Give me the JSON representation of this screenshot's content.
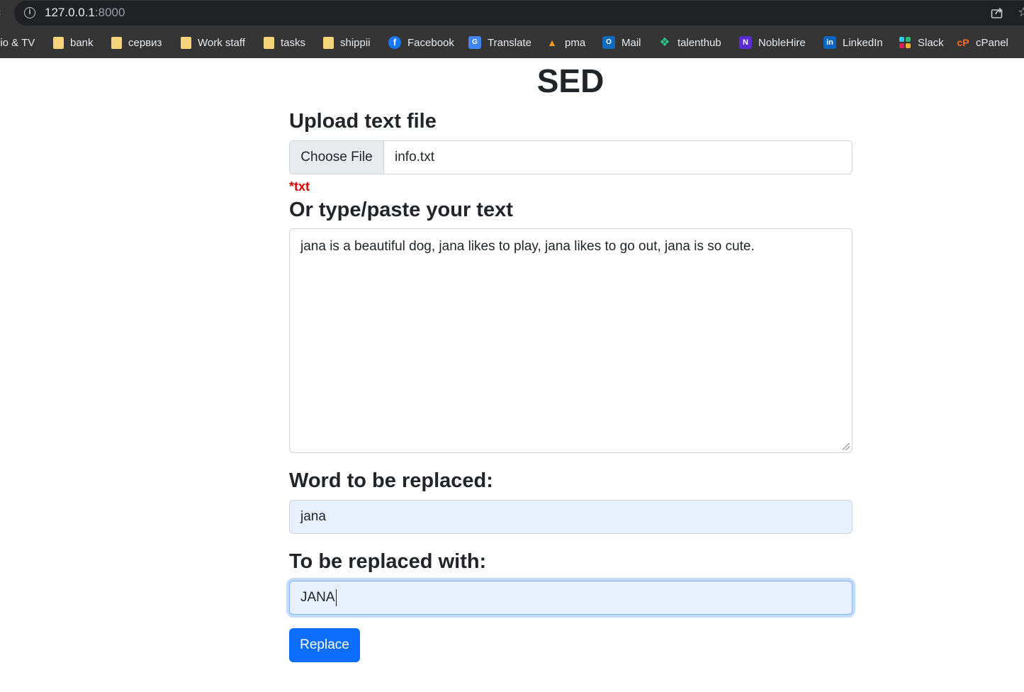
{
  "browser": {
    "url_host": "127.0.0.1",
    "url_port": ":8000",
    "bookmarks": [
      {
        "label": "lio & TV",
        "icon": "none"
      },
      {
        "label": "bank",
        "icon": "folder-icon"
      },
      {
        "label": "сервиз",
        "icon": "folder-icon"
      },
      {
        "label": "Work staff",
        "icon": "folder-icon"
      },
      {
        "label": "tasks",
        "icon": "folder-icon"
      },
      {
        "label": "shippii",
        "icon": "folder-icon"
      },
      {
        "label": "Facebook",
        "icon": "facebook-icon"
      },
      {
        "label": "Translate",
        "icon": "translate-icon"
      },
      {
        "label": "pma",
        "icon": "phpmyadmin-icon"
      },
      {
        "label": "Mail",
        "icon": "outlook-icon"
      },
      {
        "label": "talenthub",
        "icon": "talenthub-icon"
      },
      {
        "label": "NobleHire",
        "icon": "noblehire-icon"
      },
      {
        "label": "LinkedIn",
        "icon": "linkedin-icon"
      },
      {
        "label": "Slack",
        "icon": "slack-icon"
      },
      {
        "label": "cPanel",
        "icon": "cpanel-icon"
      }
    ]
  },
  "page": {
    "title": "SED",
    "upload_label": "Upload text file",
    "choose_file_label": "Choose File",
    "file_name": "info.txt",
    "file_hint": "*txt",
    "text_label": "Or type/paste your text",
    "text_value": "jana is a beautiful dog, jana likes to play, jana likes to go out, jana is so cute.",
    "word_label": "Word to be replaced:",
    "word_value": "jana",
    "replace_with_label": "To be replaced with:",
    "replace_with_value": "JANA",
    "replace_button": "Replace"
  },
  "colors": {
    "primary": "#0d6efd",
    "hint_red": "#e00000",
    "autofill_bg": "#e8f0fe",
    "chrome_bg": "#353535"
  }
}
